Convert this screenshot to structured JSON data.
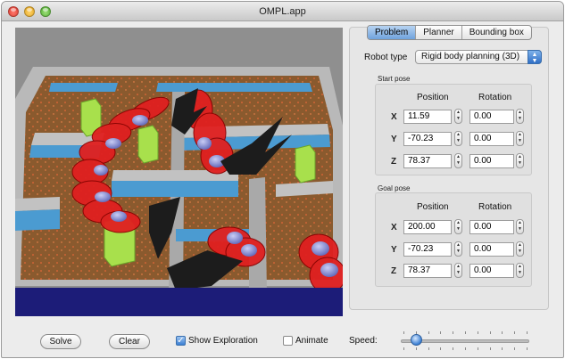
{
  "window": {
    "title": "OMPL.app"
  },
  "tabs": [
    {
      "label": "Problem",
      "active": true
    },
    {
      "label": "Planner",
      "active": false
    },
    {
      "label": "Bounding box",
      "active": false
    }
  ],
  "robot_type": {
    "label": "Robot type",
    "value": "Rigid body planning (3D)"
  },
  "start_pose": {
    "title": "Start pose",
    "position_header": "Position",
    "rotation_header": "Rotation",
    "rows": [
      {
        "axis": "X",
        "position": "11.59",
        "rotation": "0.00"
      },
      {
        "axis": "Y",
        "position": "-70.23",
        "rotation": "0.00"
      },
      {
        "axis": "Z",
        "position": "78.37",
        "rotation": "0.00"
      }
    ]
  },
  "goal_pose": {
    "title": "Goal pose",
    "position_header": "Position",
    "rotation_header": "Rotation",
    "rows": [
      {
        "axis": "X",
        "position": "200.00",
        "rotation": "0.00"
      },
      {
        "axis": "Y",
        "position": "-70.23",
        "rotation": "0.00"
      },
      {
        "axis": "Z",
        "position": "78.37",
        "rotation": "0.00"
      }
    ]
  },
  "bottom_bar": {
    "solve_label": "Solve",
    "clear_label": "Clear",
    "show_exploration_label": "Show Exploration",
    "show_exploration_checked": true,
    "animate_label": "Animate",
    "animate_checked": false,
    "speed_label": "Speed:",
    "speed_level": 0.12
  },
  "colors": {
    "accent": "#3b7fd3",
    "floor": "#8a5a2e",
    "wall_top": "#4b9bd1",
    "path_red": "#e02020",
    "robot_blue": "#8e96d8",
    "obstacle_green": "#a8e04c"
  }
}
